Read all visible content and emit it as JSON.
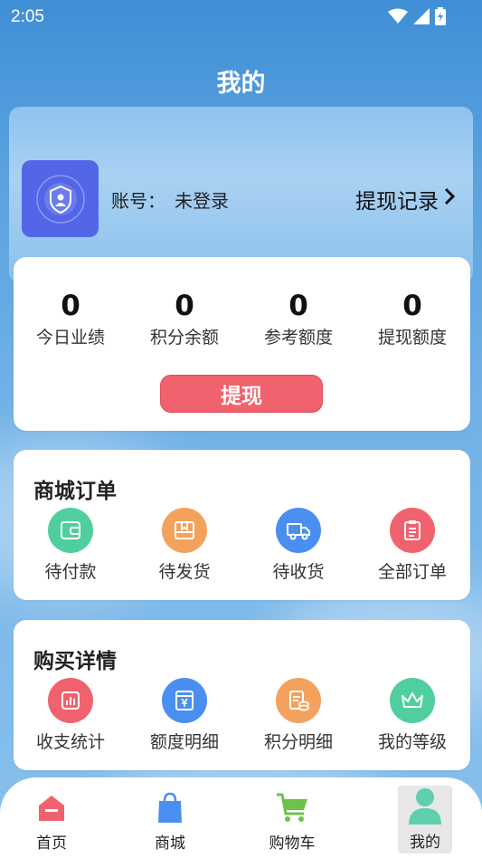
{
  "status": {
    "time": "2:05"
  },
  "page": {
    "title": "我的"
  },
  "profile": {
    "account_label": "账号：",
    "account_value": "未登录",
    "withdraw_record": "提现记录"
  },
  "stats": [
    {
      "value": "0",
      "label": "今日业绩"
    },
    {
      "value": "0",
      "label": "积分余额"
    },
    {
      "value": "0",
      "label": "参考额度"
    },
    {
      "value": "0",
      "label": "提现额度"
    }
  ],
  "withdraw_button": "提现",
  "orders": {
    "title": "商城订单",
    "items": [
      {
        "label": "待付款",
        "icon": "wallet-icon",
        "color": "#4fcf9f"
      },
      {
        "label": "待发货",
        "icon": "box-icon",
        "color": "#f3a25d"
      },
      {
        "label": "待收货",
        "icon": "truck-icon",
        "color": "#4a8ff0"
      },
      {
        "label": "全部订单",
        "icon": "clipboard-icon",
        "color": "#f0626d"
      }
    ]
  },
  "purchase": {
    "title": "购买详情",
    "items": [
      {
        "label": "收支统计",
        "icon": "stats-icon",
        "color": "#f0626d"
      },
      {
        "label": "额度明细",
        "icon": "yen-icon",
        "color": "#4a8ff0"
      },
      {
        "label": "积分明细",
        "icon": "points-icon",
        "color": "#f3a25d"
      },
      {
        "label": "我的等级",
        "icon": "crown-icon",
        "color": "#4fcf9f"
      }
    ]
  },
  "tabs": [
    {
      "label": "首页",
      "icon": "home-icon",
      "color": "#f0626d"
    },
    {
      "label": "商城",
      "icon": "shopping-bag-icon",
      "color": "#4a8ff0"
    },
    {
      "label": "购物车",
      "icon": "cart-icon",
      "color": "#6cc24a"
    },
    {
      "label": "我的",
      "icon": "user-icon",
      "color": "#5fcfae"
    }
  ]
}
